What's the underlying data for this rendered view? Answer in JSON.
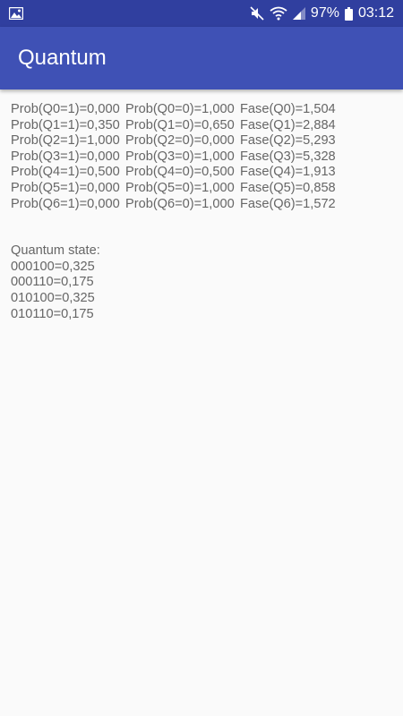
{
  "status_bar": {
    "left_icon": "image-icon",
    "battery": "97%",
    "time": "03:12",
    "icons": [
      "mute-icon",
      "wifi-icon",
      "signal-icon",
      "battery-icon"
    ]
  },
  "app_bar": {
    "title": "Quantum"
  },
  "qubits": [
    {
      "p1": "Prob(Q0=1)=0,000",
      "p0": "Prob(Q0=0)=1,000",
      "phase": "Fase(Q0)=1,504"
    },
    {
      "p1": "Prob(Q1=1)=0,350",
      "p0": "Prob(Q1=0)=0,650",
      "phase": "Fase(Q1)=2,884"
    },
    {
      "p1": "Prob(Q2=1)=1,000",
      "p0": "Prob(Q2=0)=0,000",
      "phase": "Fase(Q2)=5,293"
    },
    {
      "p1": "Prob(Q3=1)=0,000",
      "p0": "Prob(Q3=0)=1,000",
      "phase": "Fase(Q3)=5,328"
    },
    {
      "p1": "Prob(Q4=1)=0,500",
      "p0": "Prob(Q4=0)=0,500",
      "phase": "Fase(Q4)=1,913"
    },
    {
      "p1": "Prob(Q5=1)=0,000",
      "p0": "Prob(Q5=0)=1,000",
      "phase": "Fase(Q5)=0,858"
    },
    {
      "p1": "Prob(Q6=1)=0,000",
      "p0": "Prob(Q6=0)=1,000",
      "phase": "Fase(Q6)=1,572"
    }
  ],
  "state": {
    "heading": "Quantum state:",
    "entries": [
      "000100=0,325",
      "000110=0,175",
      "010100=0,325",
      "010110=0,175"
    ]
  }
}
